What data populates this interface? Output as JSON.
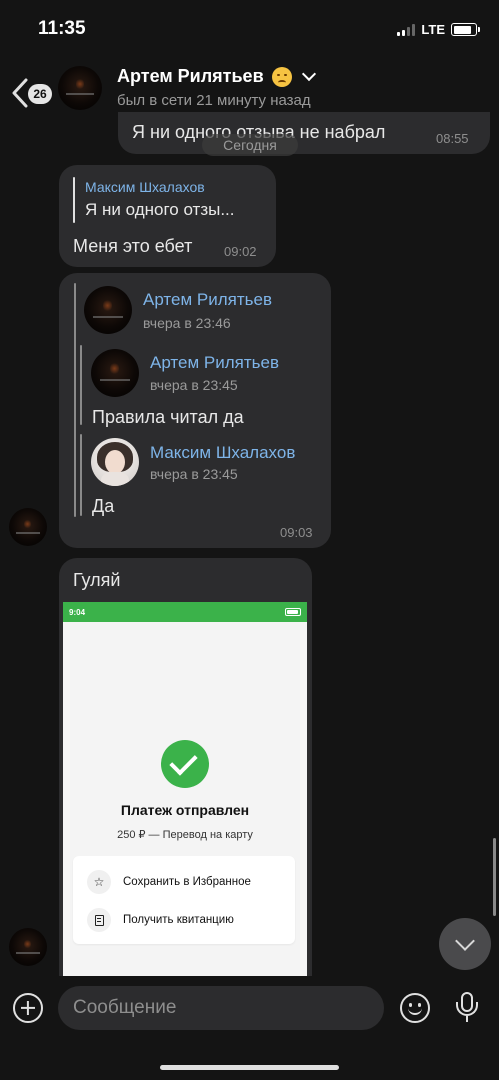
{
  "status_bar": {
    "time": "11:35",
    "network": "LTE"
  },
  "header": {
    "unread_count": "26",
    "contact_name": "Артем Рилятьев",
    "emoji": "smiling-face-with-tear-emoji",
    "last_seen": "был в сети 21 минуту назад"
  },
  "messages": {
    "outgoing_top": {
      "text": "Я ни одного отзыва не набрал",
      "time": "08:55"
    },
    "date_separator": "Сегодня",
    "reply_message": {
      "reply_author": "Максим Шхалахов",
      "reply_preview": "Я ни одного отзы...",
      "text": "Меня это ебет",
      "time": "09:02"
    },
    "forwarded_message": {
      "forward_author": "Артем Рилятьев",
      "forward_time": "вчера в 23:46",
      "nested": [
        {
          "author": "Артем Рилятьев",
          "time": "вчера в 23:45",
          "text": "Правила читал да"
        },
        {
          "author": "Максим Шхалахов",
          "time": "вчера в 23:45",
          "text": "Да"
        }
      ],
      "time": "09:03"
    },
    "image_message": {
      "text": "Гуляй",
      "screenshot": {
        "status_time": "9:04",
        "title": "Платеж отправлен",
        "subtitle": "250 ₽ — Перевод на карту",
        "actions": [
          "Сохранить в Избранное",
          "Получить квитанцию"
        ]
      }
    }
  },
  "composer": {
    "placeholder": "Сообщение"
  },
  "colors": {
    "background": "#141414",
    "bubble": "#2c2c2e",
    "link_name": "#7eb4e8",
    "success_green": "#3bb24a"
  }
}
